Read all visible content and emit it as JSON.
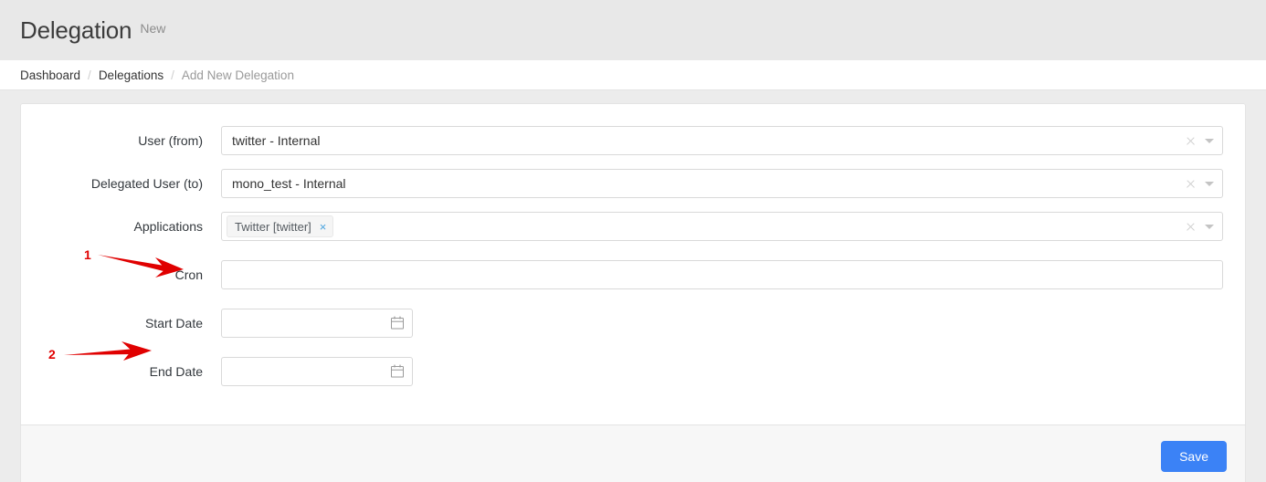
{
  "header": {
    "title": "Delegation",
    "subtitle": "New"
  },
  "breadcrumb": {
    "items": [
      {
        "label": "Dashboard",
        "current": false
      },
      {
        "label": "Delegations",
        "current": false
      },
      {
        "label": "Add New Delegation",
        "current": true
      }
    ],
    "separator": "/"
  },
  "form": {
    "user_from": {
      "label": "User (from)",
      "value": "twitter - Internal",
      "clear_icon": "close-icon",
      "caret_icon": "chevron-down-icon"
    },
    "delegated_user_to": {
      "label": "Delegated User (to)",
      "value": "mono_test - Internal",
      "clear_icon": "close-icon",
      "caret_icon": "chevron-down-icon"
    },
    "applications": {
      "label": "Applications",
      "tags": [
        {
          "label": "Twitter [twitter]",
          "remove_icon": "×"
        }
      ],
      "clear_icon": "close-icon",
      "caret_icon": "chevron-down-icon"
    },
    "cron": {
      "label": "Cron",
      "value": "",
      "placeholder": ""
    },
    "start_date": {
      "label": "Start Date",
      "value": "",
      "placeholder": "",
      "icon": "calendar-icon"
    },
    "end_date": {
      "label": "End Date",
      "value": "",
      "placeholder": "",
      "icon": "calendar-icon"
    }
  },
  "footer": {
    "save_label": "Save"
  },
  "annotations": [
    {
      "number": "1",
      "target": "cron-label"
    },
    {
      "number": "2",
      "target": "end-date-label"
    }
  ],
  "colors": {
    "accent": "#3b82f6",
    "annotation": "#e00000",
    "page_bg": "#ececec",
    "header_bg": "#e8e8e8",
    "tag_remove": "#4aa3df"
  }
}
